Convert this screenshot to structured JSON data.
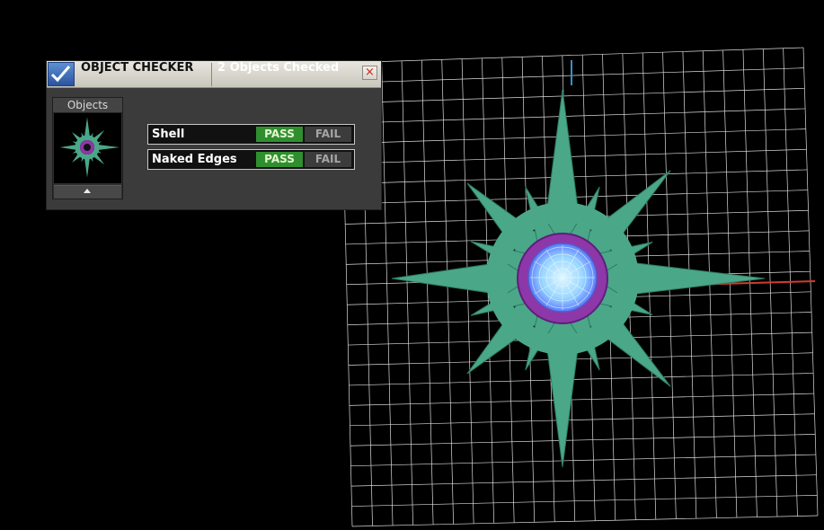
{
  "window": {
    "title": "OBJECT CHECKER",
    "status": "2  Objects Checked",
    "close_icon": "close-icon",
    "checkmark_icon": "checkmark-icon"
  },
  "objects": {
    "label": "Objects",
    "expand_icon": "up-arrow-icon"
  },
  "checks": [
    {
      "label": "Shell",
      "pass_label": "PASS",
      "fail_label": "FAIL",
      "result": "PASS"
    },
    {
      "label": "Naked Edges",
      "pass_label": "PASS",
      "fail_label": "FAIL",
      "result": "PASS"
    }
  ],
  "colors": {
    "background": "#000000",
    "grid": "#e8e8e8",
    "model_teal": "#4aa888",
    "model_purple": "#8d37a8",
    "model_blue": "#7cc6ff",
    "axis_x": "#d03c2d",
    "axis_y": "#3d8dc7",
    "pass_green": "#2f8f2f"
  }
}
